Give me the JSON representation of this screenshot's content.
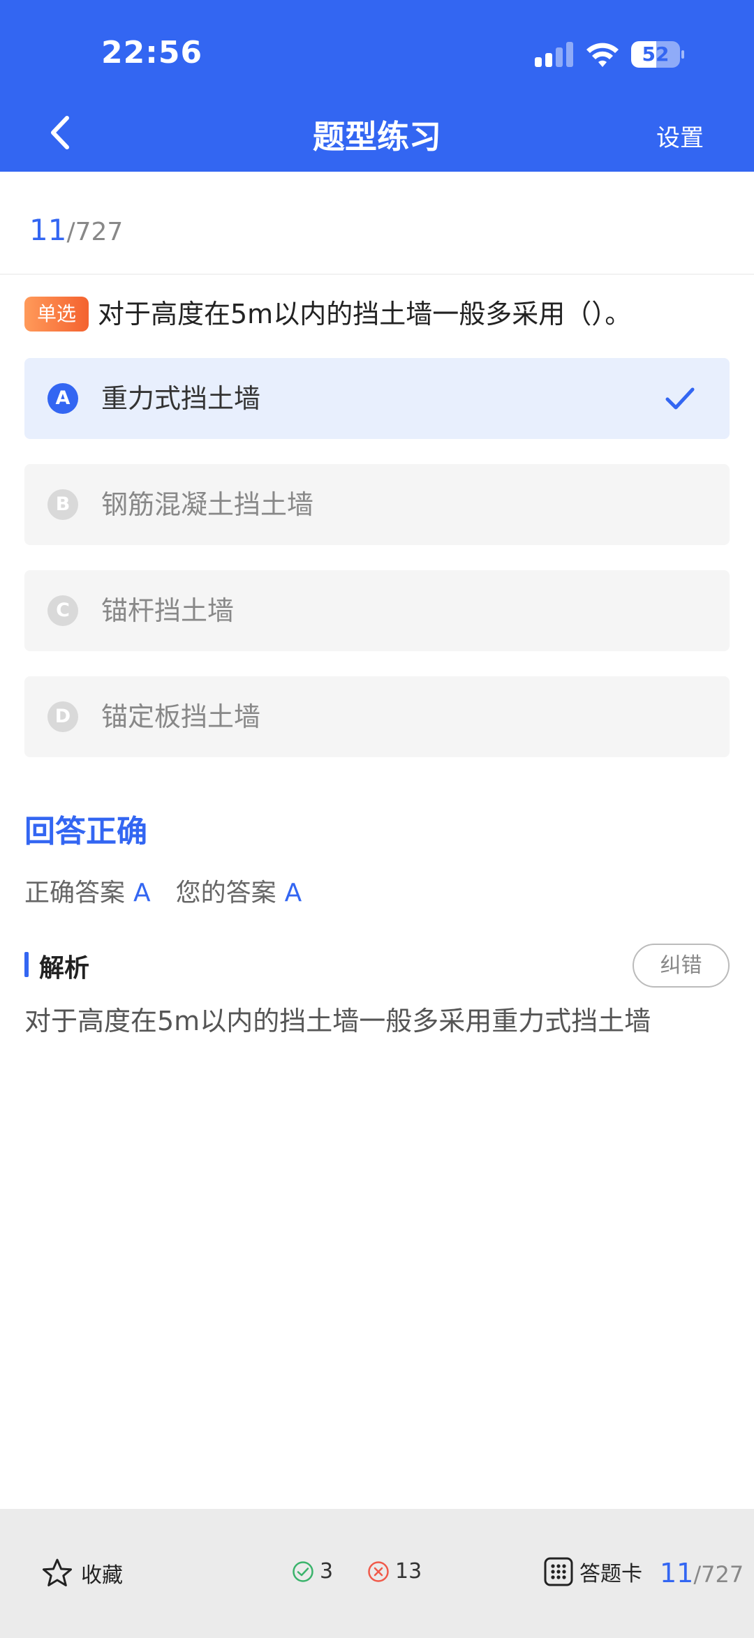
{
  "status_bar": {
    "time": "22:56",
    "battery": "52"
  },
  "nav": {
    "title": "题型练习",
    "settings_label": "设置"
  },
  "progress": {
    "current": "11",
    "total": "/727"
  },
  "question": {
    "type_tag": "单选",
    "text": "对于高度在5m以内的挡土墙一般多采用（）。",
    "options": [
      {
        "letter": "A",
        "text": "重力式挡土墙",
        "selected": true
      },
      {
        "letter": "B",
        "text": "钢筋混凝土挡土墙",
        "selected": false
      },
      {
        "letter": "C",
        "text": "锚杆挡土墙",
        "selected": false
      },
      {
        "letter": "D",
        "text": "锚定板挡土墙",
        "selected": false
      }
    ]
  },
  "result": {
    "title": "回答正确",
    "correct_label": "正确答案",
    "correct_value": "A",
    "your_label": "您的答案",
    "your_value": "A"
  },
  "analysis": {
    "title": "解析",
    "report_label": "纠错",
    "text": "对于高度在5m以内的挡土墙一般多采用重力式挡土墙"
  },
  "bottom_bar": {
    "favorite_label": "收藏",
    "correct_count": "3",
    "wrong_count": "13",
    "answer_card_label": "答题卡",
    "current": "11",
    "total": "/727"
  },
  "colors": {
    "primary": "#3366f2",
    "tag_orange": "#f4622f",
    "correct_green": "#3ab36b",
    "wrong_red": "#f05a4a"
  },
  "icons": [
    "back-chevron-icon",
    "check-icon",
    "star-icon",
    "check-circle-icon",
    "cross-circle-icon",
    "grid-icon"
  ]
}
